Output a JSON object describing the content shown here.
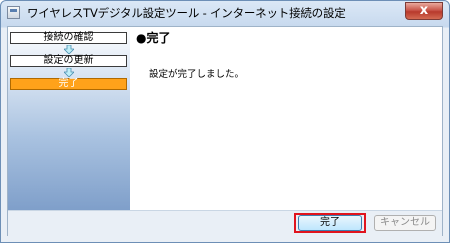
{
  "window": {
    "title": "ワイヤレスTVデジタル設定ツール - インターネット接続の設定",
    "close_symbol": "x"
  },
  "sidebar": {
    "steps": [
      {
        "label": "接続の確認",
        "state": "done"
      },
      {
        "label": "設定の更新",
        "state": "done"
      },
      {
        "label": "完了",
        "state": "active"
      }
    ]
  },
  "content": {
    "heading": "●完了",
    "message": "設定が完了しました。"
  },
  "footer": {
    "finish_label": "完了",
    "cancel_label": "キャンセル"
  },
  "colors": {
    "active_step": "#ffa21a",
    "highlight_frame": "#e0141e",
    "arrow": "#bfeef7"
  }
}
